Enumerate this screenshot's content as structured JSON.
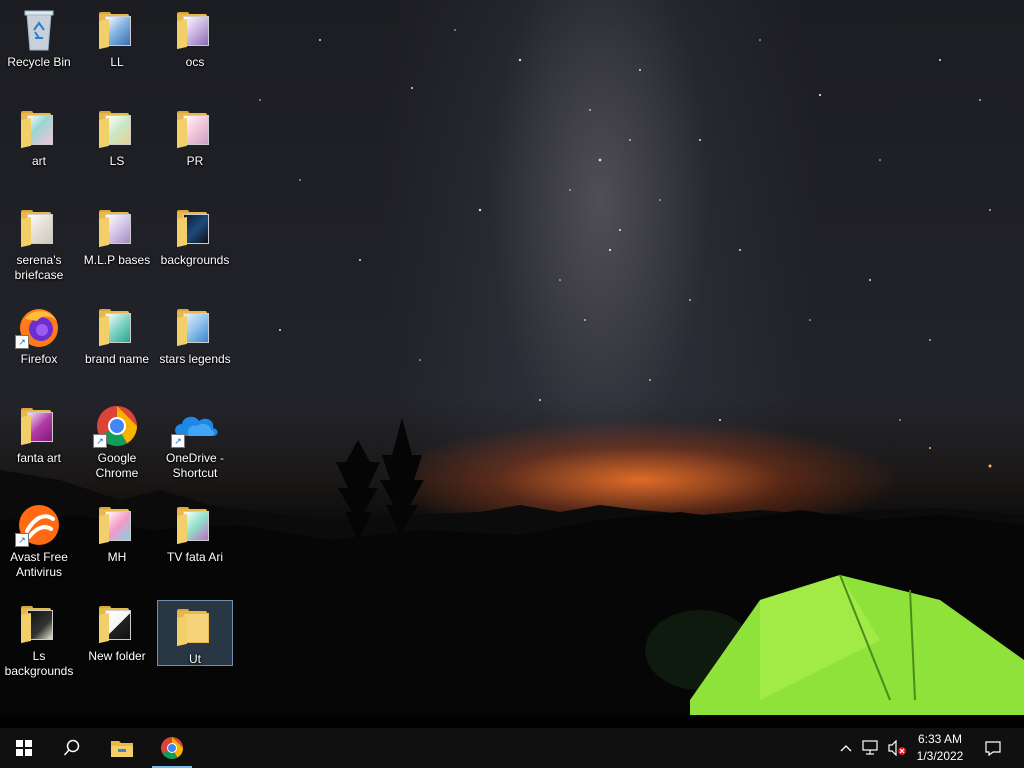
{
  "desktop": {
    "icons": [
      {
        "label": "Recycle Bin",
        "type": "recycle-bin"
      },
      {
        "label": "LL",
        "type": "folder"
      },
      {
        "label": "ocs",
        "type": "folder"
      },
      {
        "label": "art",
        "type": "folder"
      },
      {
        "label": "LS",
        "type": "folder"
      },
      {
        "label": "PR",
        "type": "folder"
      },
      {
        "label": "serena's briefcase",
        "type": "folder"
      },
      {
        "label": "M.L.P bases",
        "type": "folder"
      },
      {
        "label": "backgrounds",
        "type": "folder"
      },
      {
        "label": "Firefox",
        "type": "firefox-shortcut"
      },
      {
        "label": "brand name",
        "type": "folder"
      },
      {
        "label": "stars legends",
        "type": "folder"
      },
      {
        "label": "fanta art",
        "type": "folder"
      },
      {
        "label": "Google Chrome",
        "type": "chrome-shortcut"
      },
      {
        "label": "OneDrive - Shortcut",
        "type": "onedrive-shortcut"
      },
      {
        "label": "Avast Free Antivirus",
        "type": "avast-shortcut"
      },
      {
        "label": "MH",
        "type": "folder"
      },
      {
        "label": "TV  fata Ari",
        "type": "folder"
      },
      {
        "label": "Ls backgrounds",
        "type": "folder"
      },
      {
        "label": "New folder",
        "type": "folder"
      },
      {
        "label": "Ut",
        "type": "folder",
        "selected": true
      }
    ]
  },
  "taskbar": {
    "start_icon": "windows-logo-icon",
    "search_icon": "search-icon",
    "pinned": [
      {
        "name": "file-explorer-icon"
      },
      {
        "name": "chrome-icon",
        "active": true
      }
    ],
    "tray": {
      "overflow_icon": "chevron-up-icon",
      "network_icon": "network-icon",
      "volume_icon": "volume-muted-icon",
      "time": "6:33 AM",
      "date": "1/3/2022",
      "notification_icon": "action-center-icon"
    }
  },
  "colors": {
    "taskbar_bg": "#101010",
    "folder": "#e8b94a",
    "tent": "#8fe23a",
    "horizon_glow": "#ff7a28",
    "chrome_red": "#db4437",
    "chrome_green": "#0f9d58",
    "chrome_yellow": "#f4b400",
    "chrome_blue": "#4285f4"
  }
}
